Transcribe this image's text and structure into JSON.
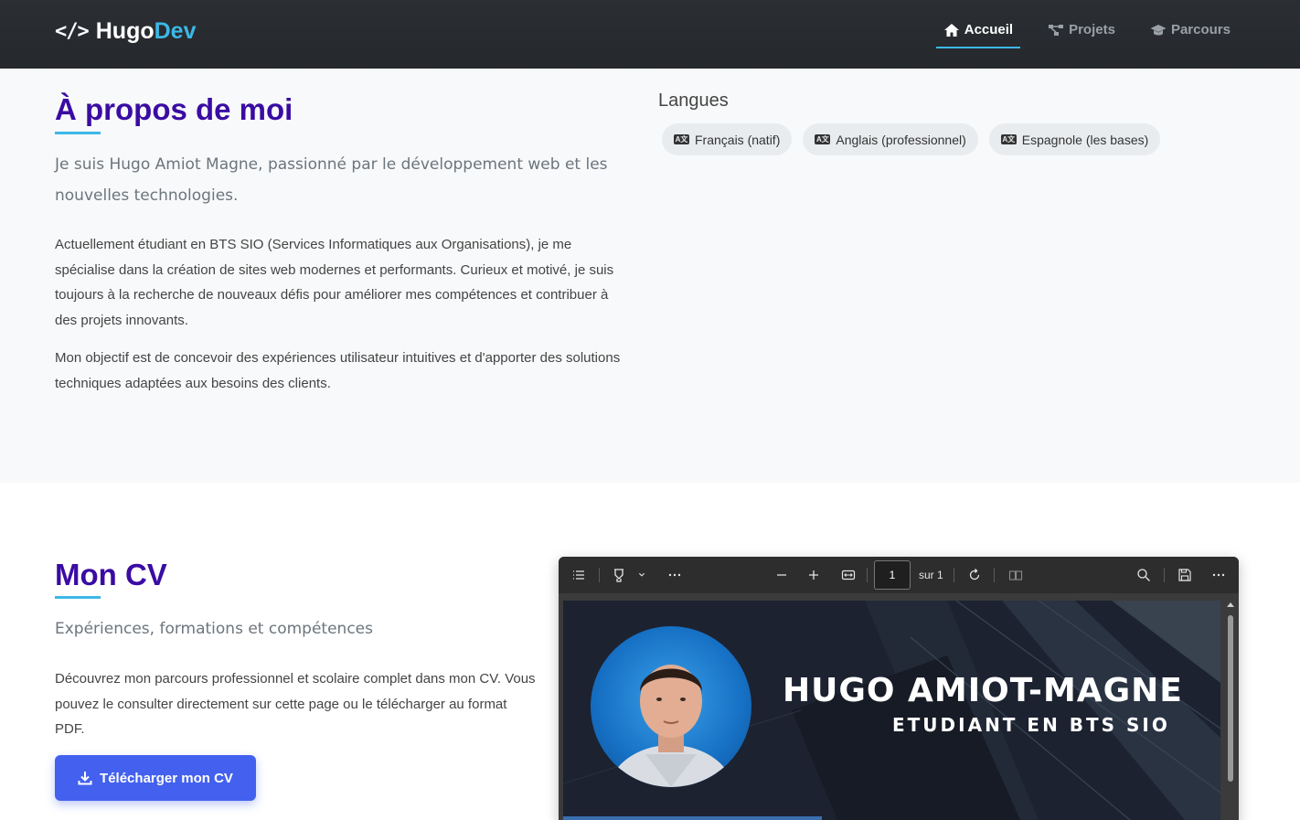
{
  "nav": {
    "brand_prefix": "Hugo",
    "brand_suffix": "Dev",
    "brand_icon": "code-icon",
    "links": [
      {
        "label": "Accueil",
        "icon": "home-icon",
        "active": true
      },
      {
        "label": "Projets",
        "icon": "project-diagram-icon",
        "active": false
      },
      {
        "label": "Parcours",
        "icon": "graduation-cap-icon",
        "active": false
      }
    ],
    "accent_color": "#3cb8e6"
  },
  "about": {
    "title": "À propos de moi",
    "lead": "Je suis Hugo Amiot Magne, passionné par le développement web et les nouvelles technologies.",
    "paragraph1": "Actuellement étudiant en BTS SIO (Services Informatiques aux Organisations), je me spécialise dans la création de sites web modernes et performants. Curieux et motivé, je suis toujours à la recherche de nouveaux défis pour améliorer mes compétences et contribuer à des projets innovants.",
    "paragraph2": "Mon objectif est de concevoir des expériences utilisateur intuitives et d'apporter des solutions techniques adaptées aux besoins des clients.",
    "languages_title": "Langues",
    "languages": [
      {
        "label": "Français (natif)",
        "icon": "language-icon"
      },
      {
        "label": "Anglais (professionnel)",
        "icon": "language-icon"
      },
      {
        "label": "Espagnole (les bases)",
        "icon": "language-icon"
      }
    ]
  },
  "cv": {
    "title": "Mon CV",
    "lead": "Expériences, formations et compétences",
    "paragraph": "Découvrez mon parcours professionnel et scolaire complet dans mon CV. Vous pouvez le consulter directement sur cette page ou le télécharger au format PDF.",
    "download_label": "Télécharger mon CV",
    "download_icon": "download-icon",
    "button_color": "#4361ee",
    "title_color": "#3a0ca3"
  },
  "pdf_viewer": {
    "page_current": "1",
    "page_total": "sur 1",
    "document": {
      "name": "HUGO AMIOT-MAGNE",
      "role": "ETUDIANT EN BTS SIO"
    }
  }
}
